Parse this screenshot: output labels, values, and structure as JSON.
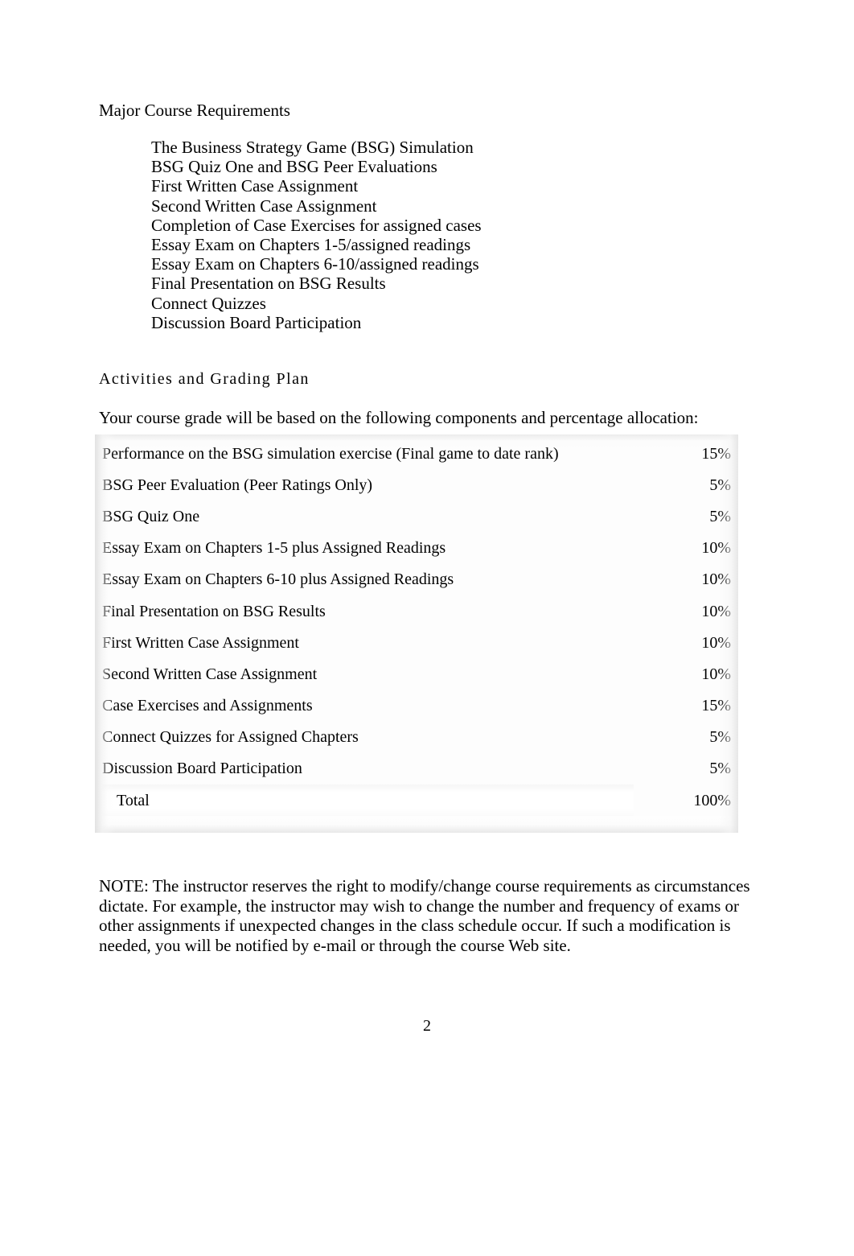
{
  "document": {
    "page_number": "2"
  },
  "requirements_section": {
    "title": "Major Course Requirements",
    "items": [
      "The Business Strategy Game (BSG) Simulation",
      "BSG Quiz One and BSG Peer Evaluations",
      "First Written Case Assignment",
      "Second Written Case Assignment",
      "Completion of Case Exercises for assigned cases",
      "Essay Exam on Chapters 1-5/assigned readings",
      "Essay Exam on Chapters 6-10/assigned readings",
      "Final Presentation on BSG Results",
      "Connect Quizzes",
      "Discussion Board Participation"
    ]
  },
  "grading_section": {
    "heading": "Activities and Grading Plan",
    "intro": "Your course grade will be based on the following components and percentage allocation:",
    "accent_color": "#dfe7d6",
    "rows": [
      {
        "component": "Performance on the BSG simulation exercise (Final game to date rank)",
        "percent": "15%"
      },
      {
        "component": "BSG Peer Evaluation (Peer Ratings Only)",
        "percent": "5%"
      },
      {
        "component": "BSG Quiz One",
        "percent": "5%"
      },
      {
        "component": "Essay Exam on Chapters 1-5 plus Assigned Readings",
        "percent": "10%"
      },
      {
        "component": "Essay Exam on Chapters 6-10 plus Assigned Readings",
        "percent": "10%"
      },
      {
        "component": "Final Presentation on BSG Results",
        "percent": "10%"
      },
      {
        "component": "First Written Case Assignment",
        "percent": "10%"
      },
      {
        "component": "Second Written Case Assignment",
        "percent": "10%"
      },
      {
        "component": "Case Exercises and Assignments",
        "percent": "15%"
      },
      {
        "component": "Connect Quizzes for Assigned Chapters",
        "percent": "5%"
      },
      {
        "component": "Discussion Board Participation",
        "percent": "5%"
      }
    ],
    "total": {
      "component": "Total",
      "percent": "100%"
    }
  },
  "note": {
    "text": "NOTE:  The instructor reserves the right to modify/change course requirements as circumstances dictate. For example, the instructor may wish to change the number and frequency of exams or other assignments if unexpected changes in the class schedule occur. If such a modification is needed, you will be notified by e-mail or through the course Web site."
  }
}
